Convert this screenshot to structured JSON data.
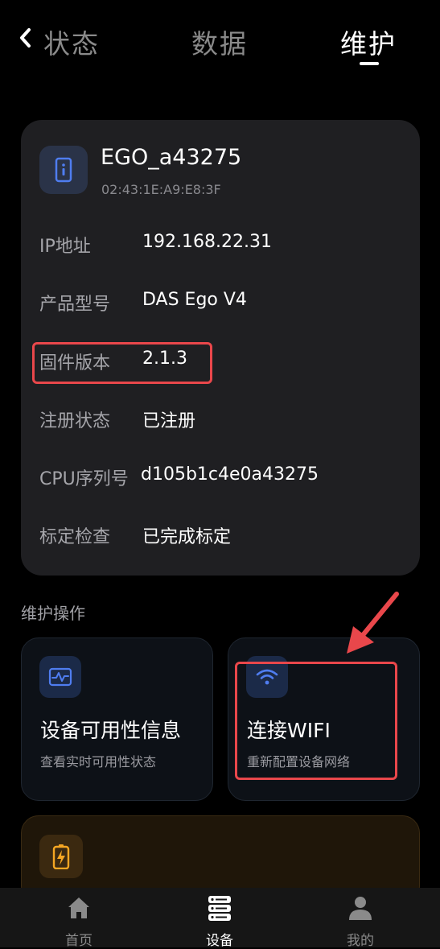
{
  "header": {
    "tabs": [
      {
        "label": "状态"
      },
      {
        "label": "数据"
      },
      {
        "label": "维护",
        "active": true
      }
    ]
  },
  "device": {
    "name": "EGO_a43275",
    "mac": "02:43:1E:A9:E8:3F",
    "icon": "device-info-icon",
    "rows": [
      {
        "label": "IP地址",
        "value": "192.168.22.31"
      },
      {
        "label": "产品型号",
        "value": "DAS Ego V4"
      },
      {
        "label": "固件版本",
        "value": "2.1.3"
      },
      {
        "label": "注册状态",
        "value": "已注册"
      },
      {
        "label": "CPU序列号",
        "value": "d105b1c4e0a43275"
      },
      {
        "label": "标定检查",
        "value": "已完成标定"
      }
    ]
  },
  "maintenance": {
    "title": "维护操作",
    "tiles": [
      {
        "title": "设备可用性信息",
        "subtitle": "查看实时可用性状态",
        "icon": "pulse-monitor-icon"
      },
      {
        "title": "连接WIFI",
        "subtitle": "重新配置设备网络",
        "icon": "wifi-icon"
      },
      {
        "icon": "battery-charging-icon"
      }
    ]
  },
  "bottom_nav": {
    "items": [
      {
        "label": "首页",
        "icon": "home-icon"
      },
      {
        "label": "设备",
        "icon": "device-list-icon",
        "active": true
      },
      {
        "label": "我的",
        "icon": "user-icon"
      }
    ]
  },
  "colors": {
    "background": "#000000",
    "card": "#1f1f22",
    "highlight_red": "#e9474b",
    "accent_blue": "#4f7df0",
    "accent_orange": "#f5a623"
  }
}
